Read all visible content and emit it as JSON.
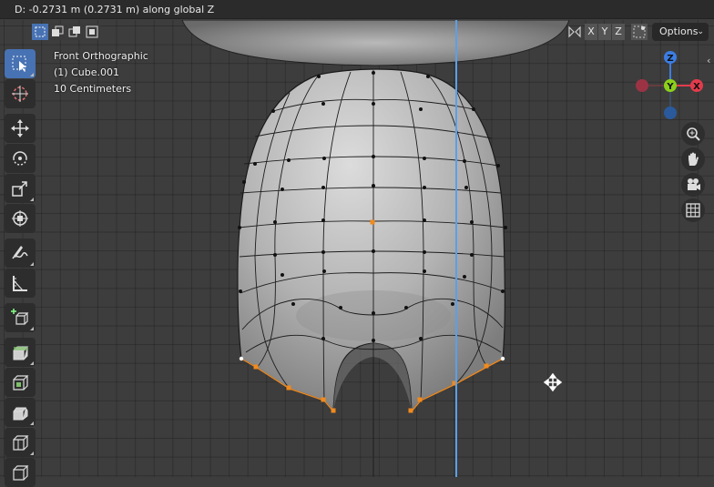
{
  "status": {
    "text": "D: -0.2731 m (0.2731 m) along global Z"
  },
  "view": {
    "name": "Front Orthographic",
    "object": "(1) Cube.001",
    "scale": "10 Centimeters"
  },
  "header": {
    "axis_x": "X",
    "axis_y": "Y",
    "axis_z": "Z",
    "options_label": "Options"
  },
  "gizmo": {
    "x_label": "X",
    "y_label": "Y",
    "z_label": "Z",
    "x_color": "#e33b4c",
    "y_color": "#8bd11c",
    "z_color": "#3b7de3"
  },
  "toolbar": {
    "tools": [
      "select-box",
      "cursor",
      "move",
      "rotate",
      "scale",
      "transform",
      "annotate",
      "measure",
      "add-cube",
      "extrude",
      "inset",
      "bevel",
      "loop-cut",
      "knife"
    ],
    "active_tool": "select-box"
  },
  "colors": {
    "accent": "#4772b3",
    "selected_vertex": "#f08a1e",
    "mesh_surface": "#c2c2c2"
  }
}
